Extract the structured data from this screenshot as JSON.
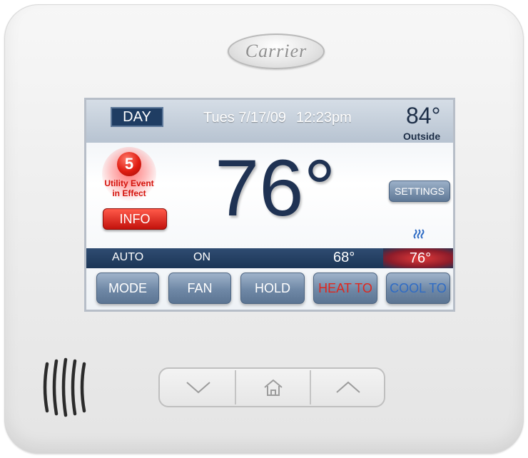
{
  "brand": {
    "logo_text": "Carrier"
  },
  "screen": {
    "mode_label": "DAY",
    "date": "Tues 7/17/09",
    "time": "12:23pm",
    "outside_temp": "84°",
    "outside_label": "Outside",
    "alert": {
      "count": "5",
      "line1": "Utility Event",
      "line2": "in Effect",
      "info_label": "INFO"
    },
    "current_temp": "76°",
    "settings_label": "SETTINGS",
    "status": {
      "mode": "AUTO",
      "fan": "ON",
      "heat_setpoint": "68°",
      "cool_setpoint": "76°"
    },
    "buttons": {
      "mode": "MODE",
      "fan": "FAN",
      "hold": "HOLD",
      "heat_to": "HEAT TO",
      "cool_to": "COOL TO"
    }
  },
  "hardware": {
    "down_icon": "chevron-down-icon",
    "home_icon": "home-icon",
    "up_icon": "chevron-up-icon",
    "speaker_icon": "speaker-grille-icon"
  },
  "colors": {
    "alert_red": "#d4140d",
    "heat_red": "#e0261c",
    "cool_blue": "#2e6bc4",
    "screen_navy": "#1f3253"
  }
}
